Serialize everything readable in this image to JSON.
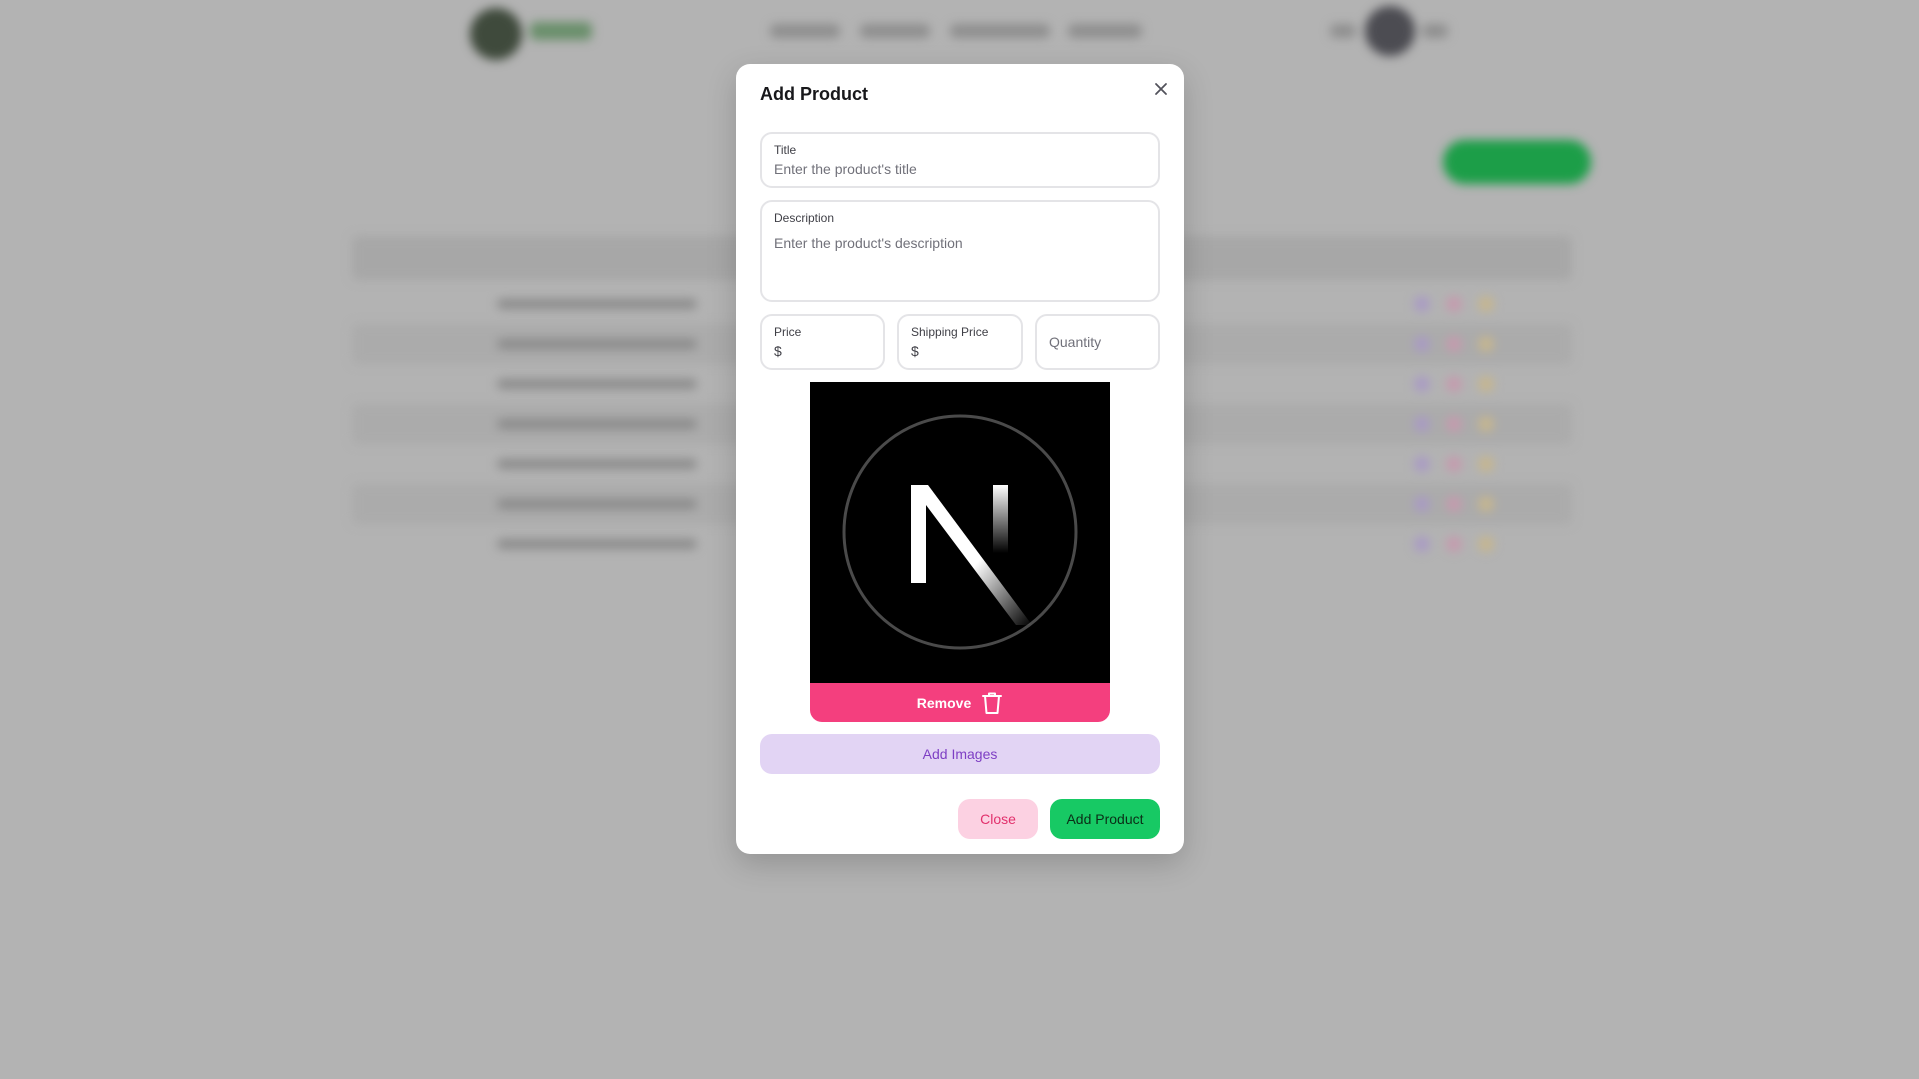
{
  "modal": {
    "title": "Add Product",
    "fields": {
      "title": {
        "label": "Title",
        "placeholder": "Enter the product's title"
      },
      "description": {
        "label": "Description",
        "placeholder": "Enter the product's description"
      },
      "price": {
        "label": "Price",
        "prefix": "$"
      },
      "shipping_price": {
        "label": "Shipping Price",
        "prefix": "$"
      },
      "quantity": {
        "placeholder": "Quantity"
      }
    },
    "image": {
      "remove_label": "Remove",
      "remove_icon": "trash-icon"
    },
    "add_images_label": "Add Images",
    "close_label": "Close",
    "submit_label": "Add Product",
    "close_icon": "close-icon"
  },
  "colors": {
    "overlay": "#b3b3b3",
    "remove_bg": "#f43f7e",
    "add_images_bg": "#e2d4f4",
    "add_images_text": "#7e3fc4",
    "close_bg": "#fcd1e2",
    "close_text": "#e2306c",
    "submit_bg": "#17c964"
  }
}
